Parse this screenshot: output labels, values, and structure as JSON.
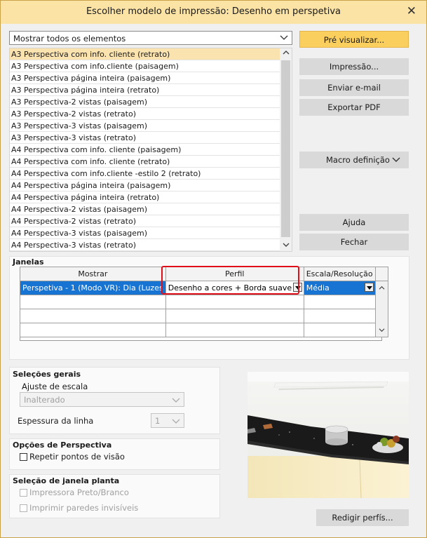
{
  "window": {
    "title": "Escolher modelo de impressão: Desenho em perspetiva",
    "close_glyph": "✕"
  },
  "filter": {
    "selected": "Mostrar todos os elementos"
  },
  "templates": [
    "A3 Perspectiva com info. cliente (retrato)",
    "A3 Perspectiva com info.cliente (paisagem)",
    "A3 Perspectiva página inteira (paisagem)",
    "A3 Perspectiva página inteira (retrato)",
    "A3 Perspectiva-2 vistas (paisagem)",
    "A3 Perspectiva-2 vistas (retrato)",
    "A3 Perspectiva-3 vistas (paisagem)",
    "A3 Perspectiva-3 vistas (retrato)",
    "A4 Perspectiva com info. cliente (paisagem)",
    "A4 Perspectiva com info. cliente (retrato)",
    "A4 Perspectiva com info.cliente -estilo 2 (retrato)",
    "A4 Perspectiva página inteira (paisagem)",
    "A4 Perspectiva página inteira (retrato)",
    "A4 Perspectiva-2 vistas (paisagem)",
    "A4 Perspectiva-2 vistas (retrato)",
    "A4 Perspectiva-3 vistas (paisagem)",
    "A4 Perspectiva-3 vistas (retrato)"
  ],
  "buttons": {
    "preview": "Pré visualizar...",
    "print": "Impressão...",
    "email": "Enviar e-mail",
    "export_pdf": "Exportar PDF",
    "macro": "Macro definição",
    "help": "Ajuda",
    "close": "Fechar",
    "edit_profiles": "Redigir perfís..."
  },
  "janelas": {
    "title": "Janelas",
    "columns": [
      "Mostrar",
      "Perfil",
      "Escala/Resolução"
    ],
    "rows": [
      {
        "mostrar": "Perspetiva - 1 (Modo VR): Dia (Luzes",
        "perfil": "Desenho a cores + Borda suave",
        "escala": "Média"
      }
    ]
  },
  "selecoes_gerais": {
    "title": "Seleções gerais",
    "scale_label": "Ajuste de escala",
    "scale_value": "Inalterado",
    "line_label": "Espessura da linha",
    "line_value": "1"
  },
  "opcoes_perspetiva": {
    "title": "Opções de Perspectiva",
    "repeat_label": "Repetir pontos de visão"
  },
  "selecao_janela": {
    "title": "Seleção de janela planta",
    "printer_label": "Impressora Preto/Branco",
    "walls_label": "Imprimir paredes invisíveis"
  },
  "colors": {
    "titlebar": "#fbe3a6",
    "primary_button": "#fbcf5e",
    "selection_blue": "#1874d2",
    "highlight_red": "#e0101a"
  }
}
